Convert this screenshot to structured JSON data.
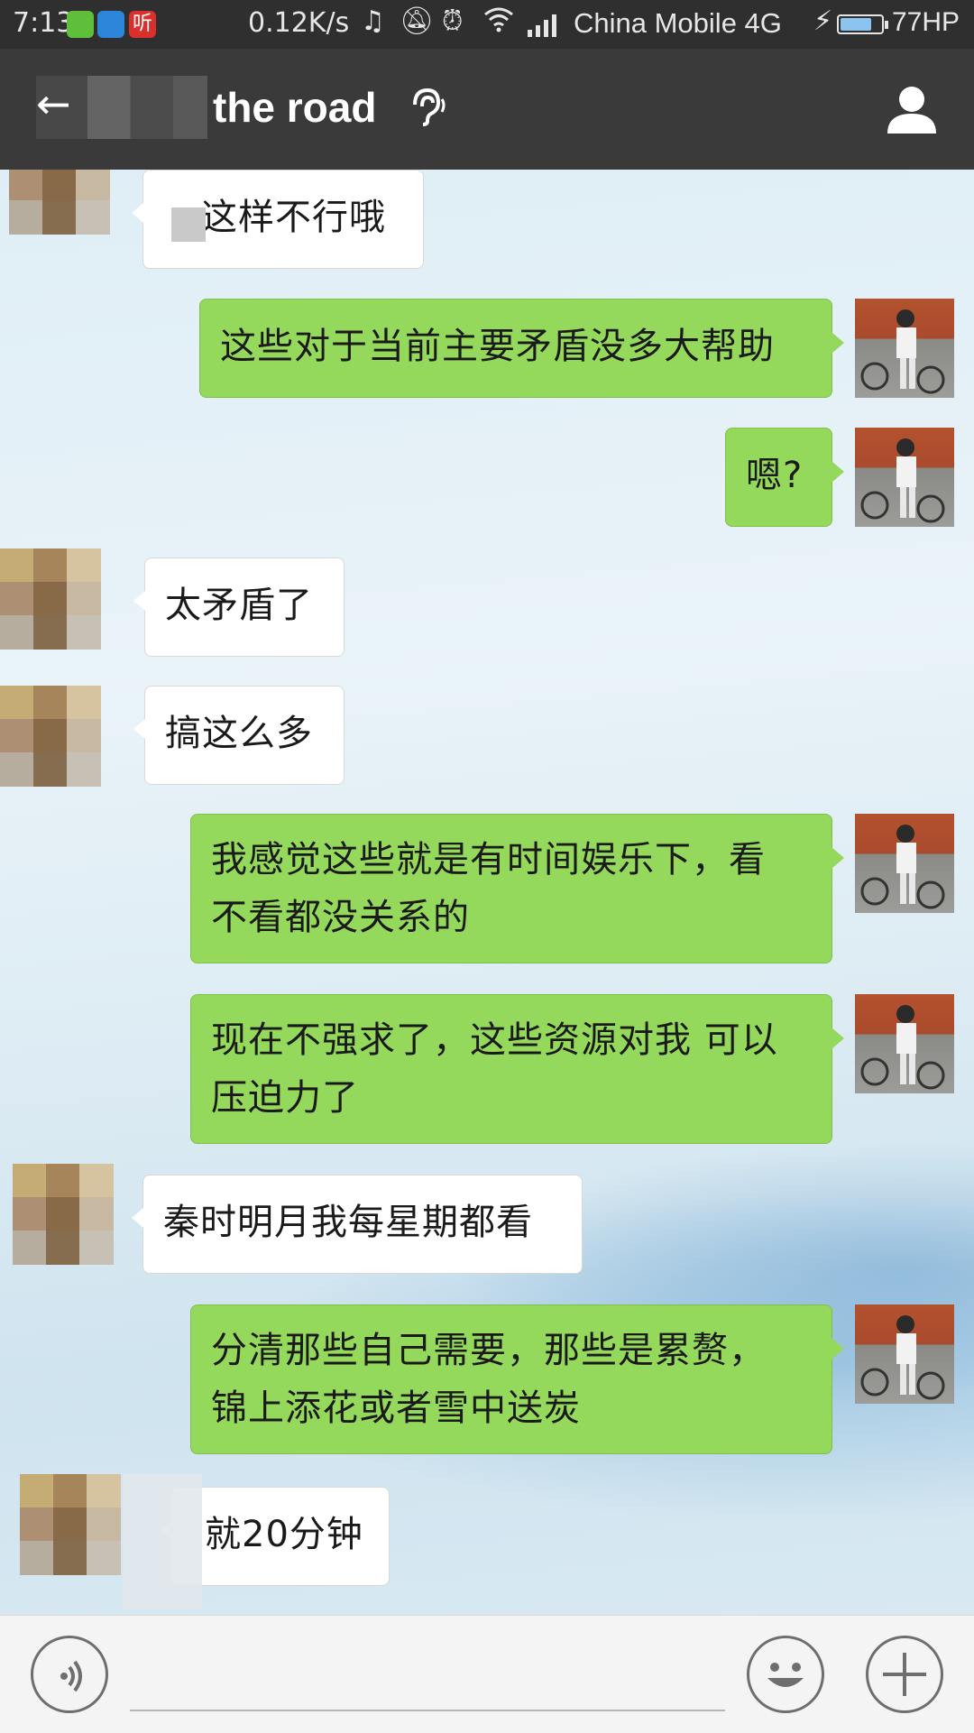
{
  "status_bar": {
    "time": "7:13",
    "app_icon_listen": "听",
    "speed": "0.12K/s",
    "carrier": "China Mobile 4G",
    "battery": "77HP",
    "battery_level": 0.77
  },
  "header": {
    "title": "the road"
  },
  "messages": [
    {
      "side": "in",
      "text": "这样不行哦"
    },
    {
      "side": "out",
      "text": "这些对于当前主要矛盾没多大帮助"
    },
    {
      "side": "out",
      "text": "嗯?"
    },
    {
      "side": "in",
      "text": "太矛盾了"
    },
    {
      "side": "in",
      "text": "搞这么多"
    },
    {
      "side": "out",
      "line1": "我感觉这些就是有时间娱乐下，看",
      "line2": "不看都没关系的"
    },
    {
      "side": "out",
      "line1": "现在不强求了，这些资源对我 可以",
      "line2": "压迫力了"
    },
    {
      "side": "in",
      "text": "秦时明月我每星期都看"
    },
    {
      "side": "out",
      "line1": "分清那些自己需要，那些是累赘，",
      "line2": "锦上添花或者雪中送炭"
    },
    {
      "side": "in",
      "text": "就20分钟"
    }
  ],
  "icons": {
    "back": "back-arrow-icon",
    "ear": "earpiece-icon",
    "profile": "profile-icon",
    "voice": "voice-icon",
    "emoji": "emoji-icon",
    "plus": "plus-icon"
  },
  "colors": {
    "outgoing_bubble": "#95d95c",
    "incoming_bubble": "#ffffff",
    "header_bg": "#3a3a3a"
  }
}
